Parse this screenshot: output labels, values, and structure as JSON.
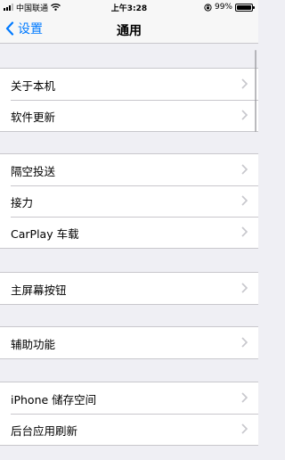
{
  "status_bar": {
    "carrier": "中国联通",
    "time": "上午3:28",
    "battery_percent": "99%",
    "battery_level": 0.99
  },
  "nav": {
    "back_label": "设置",
    "title": "通用"
  },
  "sections": [
    {
      "items": [
        "关于本机",
        "软件更新"
      ]
    },
    {
      "items": [
        "隔空投送",
        "接力",
        "CarPlay 车载"
      ]
    },
    {
      "items": [
        "主屏幕按钮"
      ]
    },
    {
      "items": [
        "辅助功能"
      ]
    },
    {
      "items": [
        "iPhone 储存空间",
        "后台应用刷新"
      ]
    }
  ],
  "colors": {
    "accent": "#007aff",
    "background": "#efeff4",
    "separator": "#c8c7cc",
    "chevron": "#c7c7cc"
  },
  "icons": [
    "signal-bars-icon",
    "wifi-icon",
    "orientation-lock-icon",
    "battery-icon",
    "back-chevron-icon",
    "disclosure-chevron-icon"
  ]
}
